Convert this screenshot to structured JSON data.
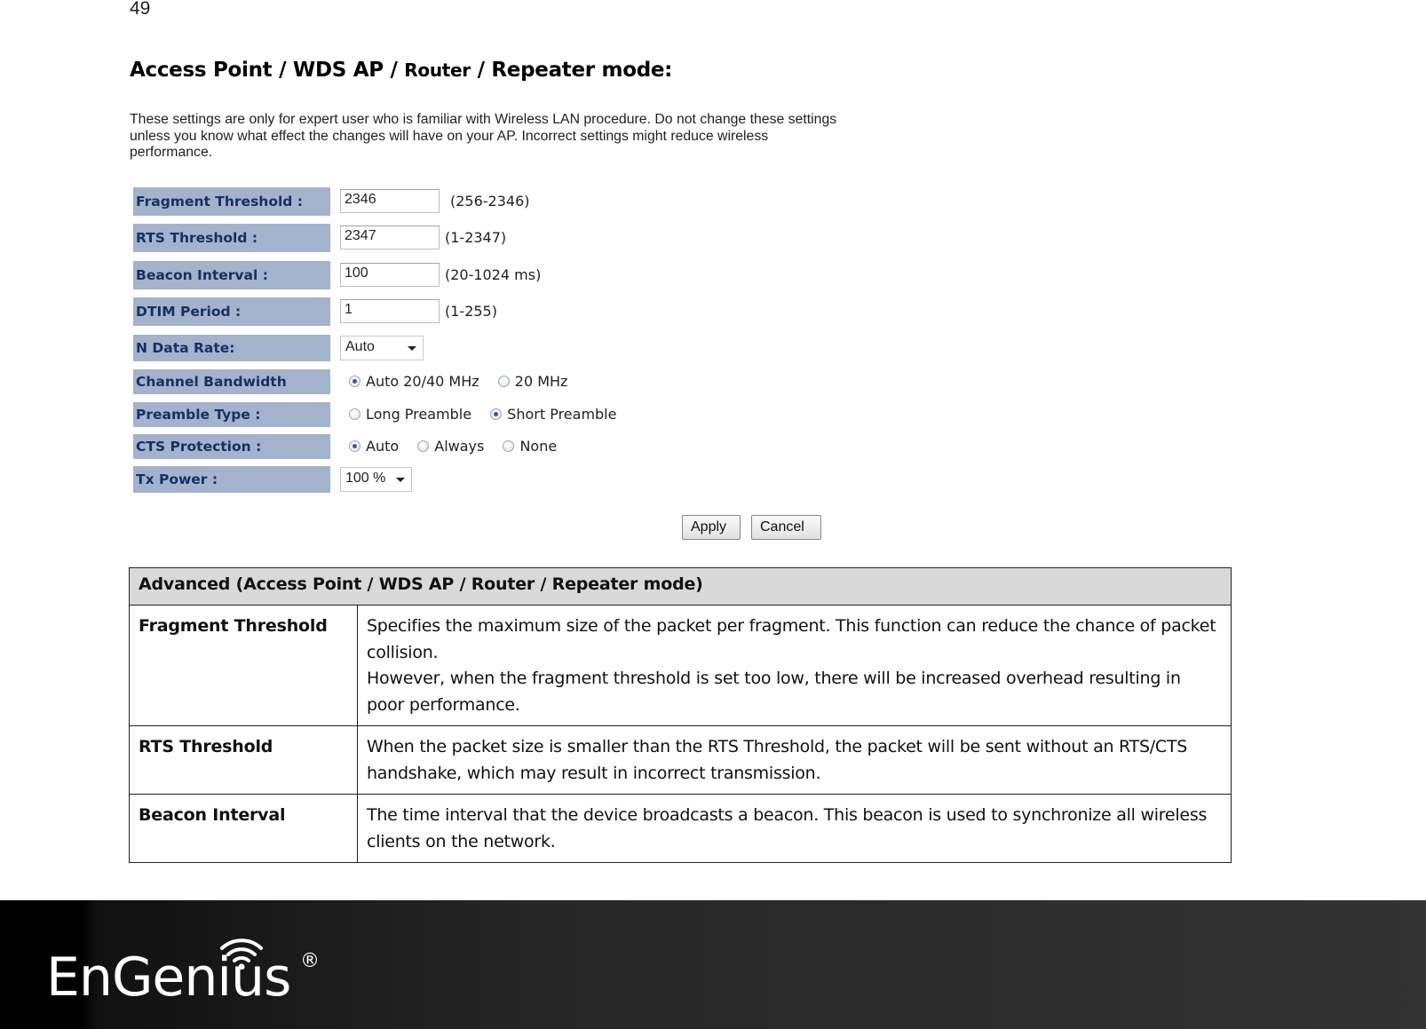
{
  "page": {
    "number": "49",
    "title_part1": "Access Point / WDS AP / ",
    "title_part2": "Router",
    "title_part3": " / Repeater mode:"
  },
  "ui": {
    "notice": "These settings are only for expert user who is familiar with Wireless LAN procedure. Do not change these settings unless you know what effect the changes will have on your AP. Incorrect settings might reduce wireless performance.",
    "fields": {
      "fragment_threshold": {
        "label": "Fragment Threshold :",
        "value": "2346",
        "range": "(256-2346)"
      },
      "rts_threshold": {
        "label": "RTS Threshold :",
        "value": "2347",
        "range": "(1-2347)"
      },
      "beacon_interval": {
        "label": "Beacon Interval :",
        "value": "100",
        "range": "(20-1024 ms)"
      },
      "dtim_period": {
        "label": "DTIM Period :",
        "value": "1",
        "range": "(1-255)"
      },
      "n_data_rate": {
        "label": "N Data Rate:",
        "selected": "Auto"
      },
      "channel_bandwidth": {
        "label": "Channel Bandwidth",
        "options": [
          {
            "label": "Auto 20/40 MHz",
            "checked": true
          },
          {
            "label": "20 MHz",
            "checked": false
          }
        ]
      },
      "preamble_type": {
        "label": "Preamble Type :",
        "options": [
          {
            "label": "Long Preamble",
            "checked": false
          },
          {
            "label": "Short Preamble",
            "checked": true
          }
        ]
      },
      "cts_protection": {
        "label": "CTS Protection :",
        "options": [
          {
            "label": "Auto",
            "checked": true
          },
          {
            "label": "Always",
            "checked": false
          },
          {
            "label": "None",
            "checked": false
          }
        ]
      },
      "tx_power": {
        "label": "Tx Power :",
        "selected": "100 %"
      }
    },
    "buttons": {
      "apply": "Apply",
      "cancel": "Cancel"
    }
  },
  "table": {
    "header": "Advanced (Access Point / WDS AP / Router / Repeater mode)",
    "rows": [
      {
        "term": "Fragment Threshold",
        "definition_lines": [
          "Specifies the maximum size of the packet per fragment. This function can reduce the chance of packet collision.",
          "However, when the fragment threshold is set too low, there will be increased overhead resulting in poor performance."
        ]
      },
      {
        "term": "RTS Threshold",
        "definition_lines": [
          "When the packet size is smaller than the RTS Threshold, the packet will be sent without an RTS/CTS handshake, which may result in incorrect transmission."
        ]
      },
      {
        "term": "Beacon Interval",
        "definition_lines": [
          "The time interval that the device broadcasts a beacon. This beacon is used to synchronize all wireless clients on the network."
        ]
      }
    ]
  },
  "footer": {
    "brand": "EnGenius",
    "registered_mark": "®",
    "logo_icon": "wifi-signal-icon"
  },
  "colors": {
    "label_bg": "#a3b3cd",
    "label_text": "#163063",
    "table_header_bg": "#d9d9d9",
    "footer_bg": "#2e2e2e"
  }
}
